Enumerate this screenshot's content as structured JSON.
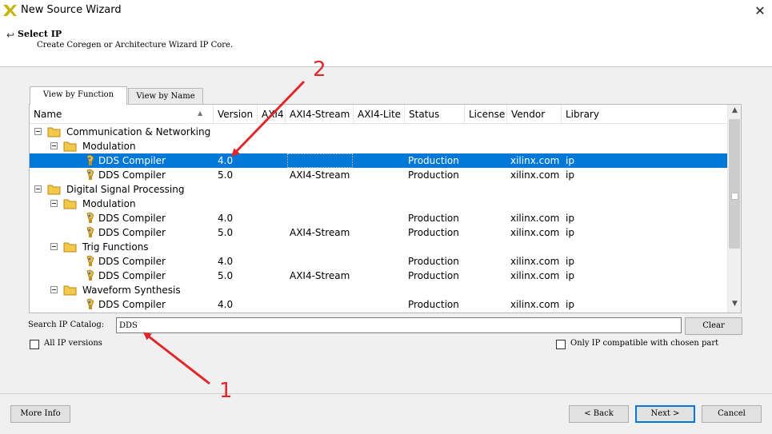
{
  "window": {
    "title": "New Source Wizard",
    "close_glyph": "✕"
  },
  "header": {
    "back_glyph": "↩",
    "title": "Select IP",
    "subtitle": "Create Coregen or Architecture Wizard IP Core."
  },
  "tabs": [
    {
      "label": "View by Function",
      "active": true
    },
    {
      "label": "View by Name",
      "active": false
    }
  ],
  "columns": [
    "Name",
    "Version",
    "AXI4",
    "AXI4-Stream",
    "AXI4-Lite",
    "Status",
    "License",
    "Vendor",
    "Library"
  ],
  "rows": [
    {
      "type": "folder",
      "name": "Communication & Networking"
    },
    {
      "type": "folder",
      "name": "Modulation"
    },
    {
      "type": "ip",
      "name": "DDS Compiler",
      "version": "4.0",
      "axi4": "",
      "axi4_stream": "",
      "axi4_lite": "",
      "status": "Production",
      "license": "",
      "vendor": "xilinx.com",
      "library": "ip",
      "selected": true
    },
    {
      "type": "ip",
      "name": "DDS Compiler",
      "version": "5.0",
      "axi4": "",
      "axi4_stream": "AXI4-Stream",
      "axi4_lite": "",
      "status": "Production",
      "license": "",
      "vendor": "xilinx.com",
      "library": "ip"
    },
    {
      "type": "folder",
      "name": "Digital Signal Processing"
    },
    {
      "type": "folder",
      "name": "Modulation"
    },
    {
      "type": "ip",
      "name": "DDS Compiler",
      "version": "4.0",
      "axi4": "",
      "axi4_stream": "",
      "axi4_lite": "",
      "status": "Production",
      "license": "",
      "vendor": "xilinx.com",
      "library": "ip"
    },
    {
      "type": "ip",
      "name": "DDS Compiler",
      "version": "5.0",
      "axi4": "",
      "axi4_stream": "AXI4-Stream",
      "axi4_lite": "",
      "status": "Production",
      "license": "",
      "vendor": "xilinx.com",
      "library": "ip"
    },
    {
      "type": "folder",
      "name": "Trig Functions"
    },
    {
      "type": "ip",
      "name": "DDS Compiler",
      "version": "4.0",
      "axi4": "",
      "axi4_stream": "",
      "axi4_lite": "",
      "status": "Production",
      "license": "",
      "vendor": "xilinx.com",
      "library": "ip"
    },
    {
      "type": "ip",
      "name": "DDS Compiler",
      "version": "5.0",
      "axi4": "",
      "axi4_stream": "AXI4-Stream",
      "axi4_lite": "",
      "status": "Production",
      "license": "",
      "vendor": "xilinx.com",
      "library": "ip"
    },
    {
      "type": "folder",
      "name": "Waveform Synthesis"
    },
    {
      "type": "ip",
      "name": "DDS Compiler",
      "version": "4.0",
      "axi4": "",
      "axi4_stream": "",
      "axi4_lite": "",
      "status": "Production",
      "license": "",
      "vendor": "xilinx.com",
      "library": "ip"
    }
  ],
  "search": {
    "label": "Search IP Catalog:",
    "value": "DDS",
    "clear_label": "Clear"
  },
  "options": {
    "all_versions_label": "All IP versions",
    "all_versions_checked": false,
    "compatible_label": "Only IP compatible with chosen part",
    "compatible_checked": false
  },
  "footer": {
    "more_info_label": "More Info",
    "back_label": "< Back",
    "next_label": "Next >",
    "cancel_label": "Cancel"
  },
  "annotations": [
    {
      "label": "1"
    },
    {
      "label": "2"
    }
  ],
  "colors": {
    "selection": "#0078d7",
    "annotation": "#e0282c",
    "folder": "#f4c84a"
  },
  "icons": {
    "folder": "folder-icon",
    "ip_core": "ip-core-icon",
    "logo": "xilinx-logo-icon"
  }
}
